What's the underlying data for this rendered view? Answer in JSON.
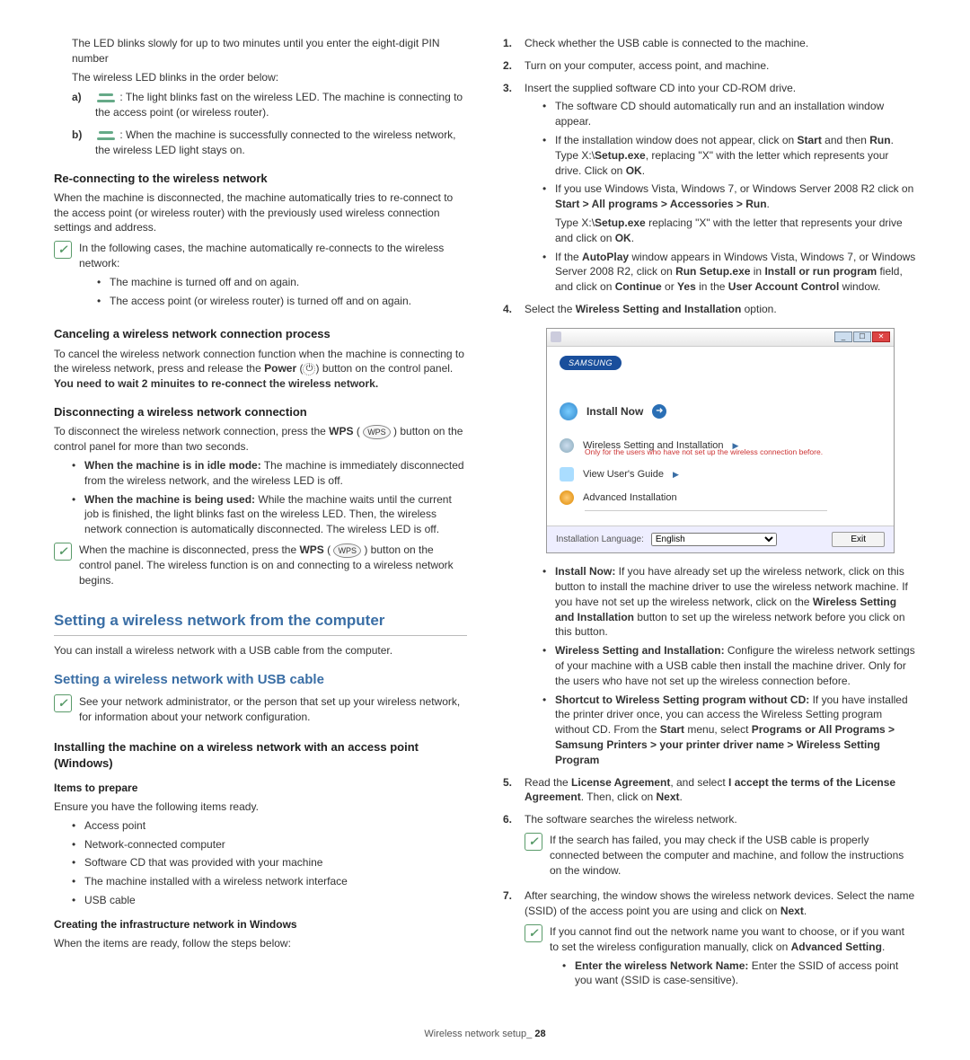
{
  "left": {
    "intro": {
      "p1": "The LED blinks slowly for up to two minutes until you enter the eight-digit PIN number",
      "p2": "The wireless LED blinks in the order below:",
      "a_marker": "a)",
      "a_text_before": ": The light blinks fast on the wireless LED. The machine is connecting to the access point (or wireless router).",
      "b_marker": "b)",
      "b_text": ": When the machine is successfully connected to the wireless network, the wireless LED light stays on."
    },
    "reconnecting": {
      "title": "Re-connecting to the wireless network",
      "p1": "When the machine is disconnected, the machine automatically tries to re-connect to the access point (or wireless router) with the previously used wireless connection settings and address.",
      "note_intro": "In the following cases, the machine automatically re-connects to the wireless network:",
      "b1": "The machine is turned off and on again.",
      "b2": "The access point (or wireless router) is turned off and on again."
    },
    "canceling": {
      "title": "Canceling a wireless network connection process",
      "p1_a": "To cancel the wireless network connection function when the machine is connecting to the wireless network, press and release the ",
      "p1_power": "Power",
      "p1_b": " button on the control panel. ",
      "p1_bold": "You need to wait 2 minuites to re-connect the wireless network."
    },
    "disconnecting": {
      "title": "Disconnecting a wireless network connection",
      "p1_a": "To disconnect the wireless network connection, press the ",
      "p1_wps": "WPS",
      "p1_b": " button on the control panel for more than two seconds.",
      "b1_label": "When the machine is in idle mode:",
      "b1_text": " The machine is immediately disconnected from the wireless network, and the wireless LED is off.",
      "b2_label": "When the machine is being used:",
      "b2_text": " While the machine waits until the current job is finished, the light blinks fast on the wireless LED. Then, the wireless network connection is automatically disconnected. The wireless LED is off.",
      "note_a": "When the machine is disconnected, press the ",
      "note_wps": "WPS",
      "note_b": " button on the control panel. The wireless function is on and connecting to a wireless network begins."
    },
    "setting_main": "Setting a wireless network from the computer",
    "setting_intro": "You can install a wireless network with a USB cable from the computer.",
    "usb": {
      "title": "Setting a wireless network with USB cable",
      "note": "See your network administrator, or the person that set up your wireless network, for information about your network configuration.",
      "install_title": "Installing the machine on a wireless network with an access point (Windows)",
      "items_title": "Items to prepare",
      "items_intro": "Ensure you have the following items ready.",
      "i1": "Access point",
      "i2": "Network-connected computer",
      "i3": "Software CD that was provided with your machine",
      "i4": "The machine installed with a wireless network interface",
      "i5": "USB cable",
      "create_title": "Creating the infrastructure network in Windows",
      "create_intro": "When the items are ready, follow the steps below:"
    }
  },
  "right": {
    "steps": {
      "s1": "Check whether the USB cable is connected to the machine.",
      "s2": "Turn on your computer, access point, and machine.",
      "s3": "Insert the supplied software CD into your CD-ROM drive.",
      "s3_b1": "The software CD should automatically run and an installation window appear.",
      "s3_b2_a": "If the installation window does not appear, click on ",
      "s3_b2_start": "Start",
      "s3_b2_b": " and then ",
      "s3_b2_run": "Run",
      "s3_b2_c": ". Type X:\\",
      "s3_b2_setup": "Setup.exe",
      "s3_b2_d": ", replacing \"X\" with the letter which represents your drive. Click on ",
      "s3_b2_ok": "OK",
      "s3_b2_e": ".",
      "s3_b3_a": "If you use Windows Vista, Windows 7, or Windows Server 2008 R2 click on ",
      "s3_b3_path": "Start > All programs > Accessories > Run",
      "s3_b3_b": ".",
      "s3_b3_p2_a": "Type X:\\",
      "s3_b3_p2_setup": "Setup.exe",
      "s3_b3_p2_b": " replacing \"X\" with the letter that represents your drive and click on ",
      "s3_b3_p2_ok": "OK",
      "s3_b3_p2_c": ".",
      "s3_b4_a": "If the ",
      "s3_b4_autoplay": "AutoPlay",
      "s3_b4_b": " window appears in Windows Vista, Windows 7, or Windows Server 2008 R2, click on ",
      "s3_b4_run": "Run Setup.exe",
      "s3_b4_c": " in ",
      "s3_b4_install": "Install or run program",
      "s3_b4_d": " field, and click on ",
      "s3_b4_cont": "Continue",
      "s3_b4_e": " or ",
      "s3_b4_yes": "Yes",
      "s3_b4_f": " in the ",
      "s3_b4_uac": "User Account Control",
      "s3_b4_g": " window.",
      "s4_a": "Select the ",
      "s4_opt": "Wireless Setting and Installation",
      "s4_b": " option."
    },
    "installer": {
      "logo": "SAMSUNG",
      "install_now": "Install Now",
      "wireless": "Wireless Setting and Installation",
      "hint": "Only for the users who have not set up the wireless connection before.",
      "view_guide": "View User's Guide",
      "advanced": "Advanced Installation",
      "lang_label": "Installation Language:",
      "lang_value": "English",
      "exit": "Exit"
    },
    "after": {
      "b1_label": "Install Now:",
      "b1_text": " If you have already set up the wireless network, click on this button to install the machine driver to use the wireless network machine. If you have not set up the wireless network, click on the ",
      "b1_bold": "Wireless Setting and Installation",
      "b1_text2": " button to set up the wireless network before you click on this button.",
      "b2_label": "Wireless Setting and Installation:",
      "b2_text": " Configure the wireless network settings of your machine with a USB cable then install the machine driver. Only for the users who have not set up the wireless connection before.",
      "b3_label": "Shortcut to Wireless Setting program without CD:",
      "b3_text_a": " If you have installed the printer driver once, you can access the Wireless Setting program without CD. From the ",
      "b3_start": "Start",
      "b3_text_b": " menu, select ",
      "b3_path": "Programs or All Programs > Samsung Printers > your printer driver name > Wireless Setting Program",
      "s5_a": "Read the ",
      "s5_la": "License Agreement",
      "s5_b": ", and select ",
      "s5_accept": "I accept the terms of the License Agreement",
      "s5_c": ". Then, click on ",
      "s5_next": "Next",
      "s5_d": ".",
      "s6": "The software searches the wireless network.",
      "s6_note": "If the search has failed, you may check if the USB cable is properly connected between the computer and machine, and follow the instructions on the window.",
      "s7_a": "After searching, the window shows the wireless network devices. Select the name (SSID) of the access point you are using and click on ",
      "s7_next": "Next",
      "s7_b": ".",
      "s7_note_a": "If you cannot find out the network name you want to choose, or if you want to set the wireless configuration manually, click on ",
      "s7_note_adv": "Advanced Setting",
      "s7_note_b": ".",
      "s7_sub_label": "Enter the wireless Network Name:",
      "s7_sub_text": " Enter the SSID of access point you want (SSID is case-sensitive)."
    }
  },
  "footer": {
    "text": "Wireless network setup",
    "page": "28"
  }
}
